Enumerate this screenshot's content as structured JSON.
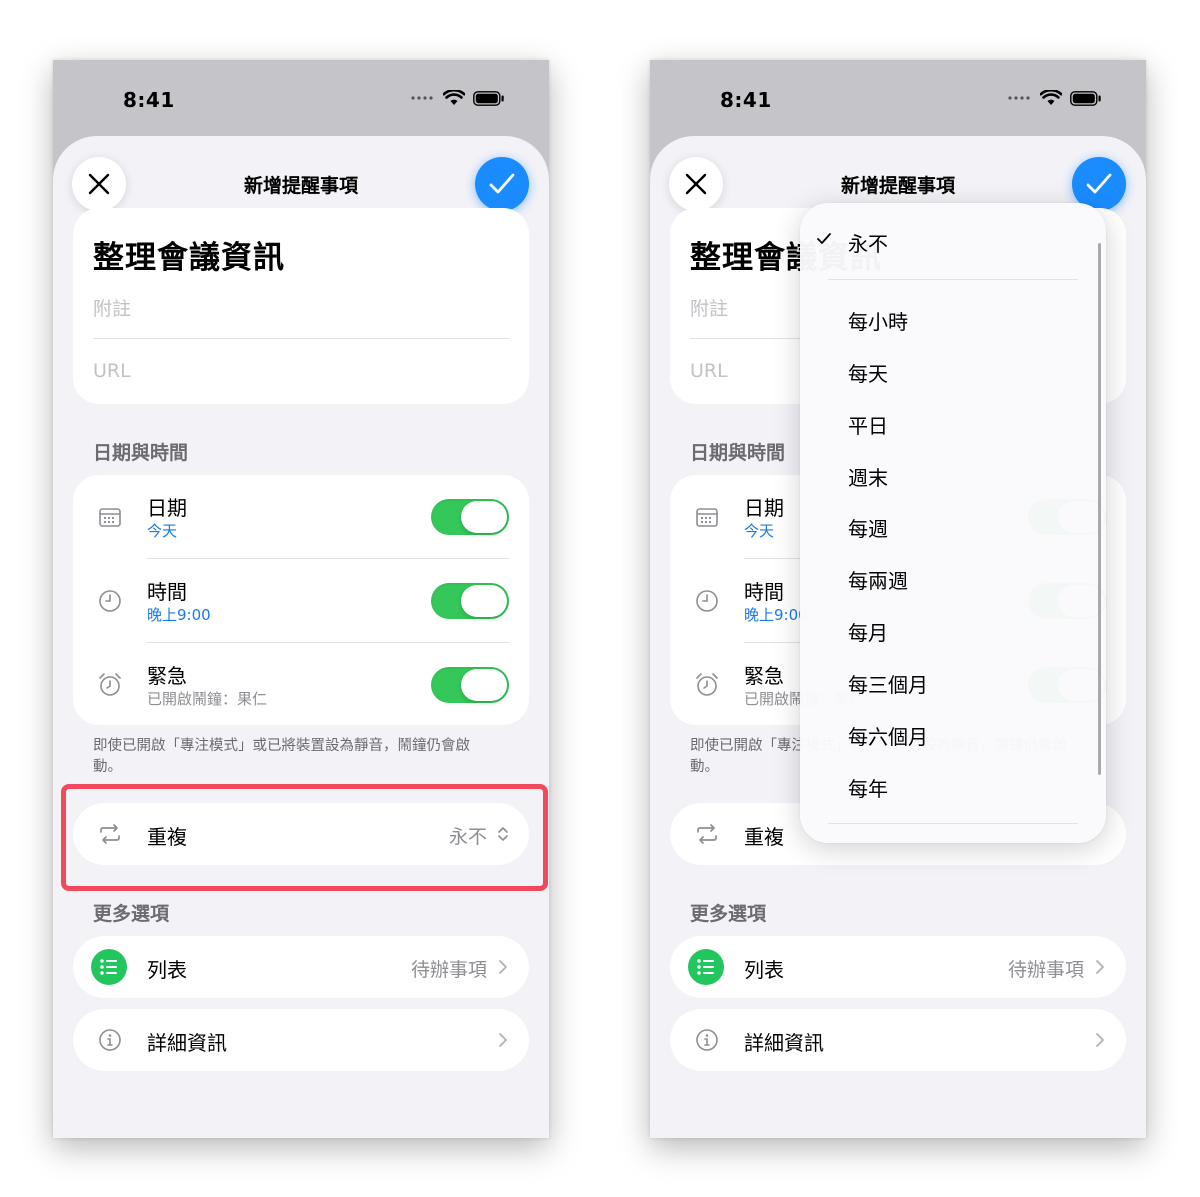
{
  "status_bar": {
    "time": "8:41"
  },
  "header": {
    "title": "新增提醒事項"
  },
  "task": {
    "title": "整理會議資訊",
    "notes_placeholder": "附註",
    "url_placeholder": "URL"
  },
  "date_time": {
    "section_label": "日期與時間",
    "rows": [
      {
        "label": "日期",
        "value": "今天",
        "icon": "calendar-icon",
        "toggle_on": true
      },
      {
        "label": "時間",
        "value": "晚上9:00",
        "icon": "clock-icon",
        "toggle_on": true
      },
      {
        "label": "緊急",
        "value": "已開啟鬧鐘：果仁",
        "icon": "alarm-clock-icon",
        "toggle_on": true
      }
    ],
    "footnote": "即使已開啟「專注模式」或已將裝置設為靜音，鬧鐘仍會啟動。"
  },
  "repeat": {
    "label": "重複",
    "value": "永不",
    "icon": "repeat-icon"
  },
  "more_options": {
    "section_label": "更多選項",
    "list": {
      "label": "列表",
      "value": "待辦事項",
      "icon": "list-icon"
    },
    "details": {
      "label": "詳細資訊",
      "icon": "info-icon"
    }
  },
  "repeat_menu": {
    "selected": "永不",
    "options": [
      "永不",
      "每小時",
      "每天",
      "平日",
      "週末",
      "每週",
      "每兩週",
      "每月",
      "每三個月",
      "每六個月",
      "每年"
    ]
  },
  "colors": {
    "accent": "#1a8cff",
    "toggle_on": "#34c759",
    "highlight": "#f04a5c",
    "list_icon": "#22c55e"
  }
}
